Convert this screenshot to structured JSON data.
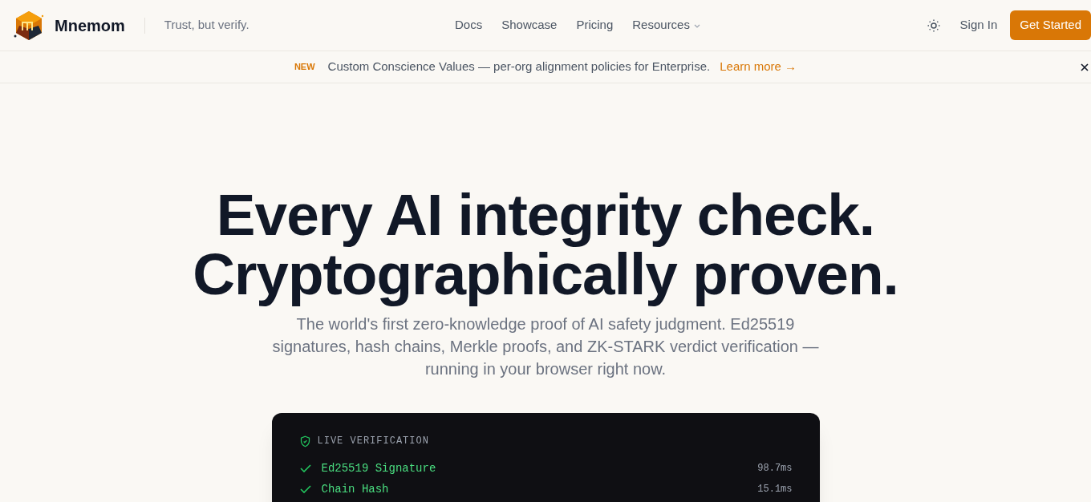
{
  "header": {
    "brand": "Mnemom",
    "tagline": "Trust, but verify.",
    "nav": [
      {
        "label": "Docs",
        "dropdown": false
      },
      {
        "label": "Showcase",
        "dropdown": false
      },
      {
        "label": "Pricing",
        "dropdown": false
      },
      {
        "label": "Resources",
        "dropdown": true
      }
    ],
    "sign_in": "Sign In",
    "cta": "Get Started"
  },
  "banner": {
    "badge": "NEW",
    "text": "Custom Conscience Values — per-org alignment policies for Enterprise.",
    "link": "Learn more →"
  },
  "hero": {
    "title_lines": [
      "Every AI integrity check.",
      "Cryptographically proven."
    ],
    "subtitle": "The world's first zero-knowledge proof of AI safety judgment. Ed25519 signatures, hash chains, Merkle proofs, and ZK-STARK verdict verification — running in your browser right now."
  },
  "verification": {
    "title": "LIVE VERIFICATION",
    "checks": [
      {
        "name": "Ed25519 Signature",
        "time": "98.7ms",
        "passed": true
      },
      {
        "name": "Chain Hash",
        "time": "15.1ms",
        "passed": true
      }
    ]
  }
}
